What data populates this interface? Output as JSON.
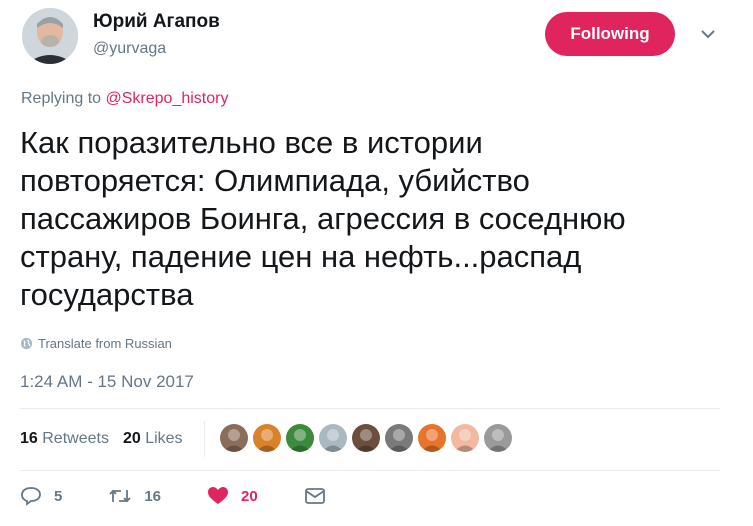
{
  "author": {
    "name": "Юрий Агапов",
    "handle": "@yurvaga"
  },
  "follow_label": "Following",
  "reply": {
    "prefix": "Replying to",
    "mention": "@Skrepo_history"
  },
  "tweet": {
    "text_lines": [
      "Как поразительно все в истории",
      "повторяется: Олимпиада, убийство",
      "пассажиров Боинга, агрессия в соседнюю",
      "страну, падение цен на нефть...распад",
      "государства"
    ]
  },
  "translate_label": "Translate from Russian",
  "timestamp": "1:24 AM - 15 Nov 2017",
  "stats": {
    "retweets_count": "16",
    "retweets_label": "Retweets",
    "likes_count": "20",
    "likes_label": "Likes"
  },
  "actions": {
    "reply_count": "5",
    "retweet_count": "16",
    "like_count": "20"
  },
  "likers": [
    {
      "color": "#8a6d5a"
    },
    {
      "color": "#d9822b"
    },
    {
      "color": "#3c8b3c"
    },
    {
      "color": "#aab8c2"
    },
    {
      "color": "#6b4e3d"
    },
    {
      "color": "#7a7a7a"
    },
    {
      "color": "#e8742b"
    },
    {
      "color": "#f2b8a0"
    },
    {
      "color": "#9a9a9a"
    }
  ],
  "colors": {
    "accent": "#e0245e",
    "muted": "#657786"
  }
}
